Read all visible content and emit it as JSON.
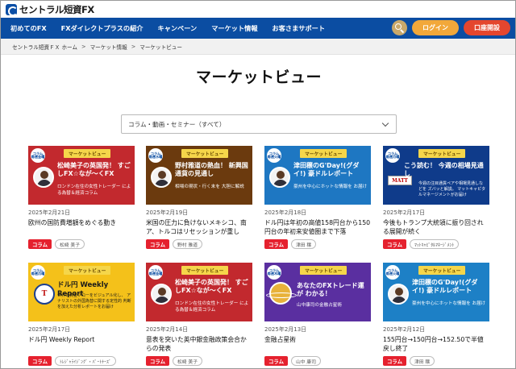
{
  "header": {
    "logo": "セントラル短資FX",
    "nav": [
      "初めてのFX",
      "FXダイレクトプラスの紹介",
      "キャンペーン",
      "マーケット情報",
      "お客さまサポート"
    ],
    "login_label": "ログイン",
    "open_account_label": "口座開設"
  },
  "breadcrumb": [
    "セントラル短資ＦＸ ホーム",
    "マーケット情報",
    "マーケットビュー"
  ],
  "page_title": "マーケットビュー",
  "filter": {
    "selected": "コラム・動画・セミナー（すべて）"
  },
  "cards": [
    {
      "banner_tag": "マーケットビュー",
      "banner_bubble": "コラム 毎週金曜",
      "banner_title": "松崎美子の英国発！ すごしFX☆なが～くFX",
      "banner_sub": "ロンドン在住の女性トレーダー による為替＆経済コラム",
      "date": "2025年2月21日",
      "title": "欧州の国防費増額をめぐる動き",
      "category": "コラム",
      "author": "松崎 美子"
    },
    {
      "banner_tag": "マーケットビュー",
      "banner_bubble": "コラム 毎週水曜",
      "banner_title": "野村雅道の熱血！ 新興国通貨の見通し",
      "banner_sub": "相場の現状・行く末を 大胆に解説",
      "date": "2025年2月19日",
      "title": "米国の圧力に負けないメキシコ、南ア、トルコはリセッションが重し",
      "category": "コラム",
      "author": "野村 雅道"
    },
    {
      "banner_tag": "マーケットビュー",
      "banner_bubble": "コラム 毎週火曜",
      "banner_title": "津田穣のG'Day!(グダイ!) 豪ドルレポート",
      "banner_sub": "豪州を中心にホットな情報を お届け",
      "date": "2025年2月18日",
      "title": "ドル円は年初の高値158円台から150円台の年初来安値圏まで下落",
      "category": "コラム",
      "author": "津田 穣"
    },
    {
      "banner_tag": "マーケットビュー",
      "banner_bubble": "コラム 毎週月曜",
      "banner_title": "こう読む！ 今週の相場見通し",
      "banner_sub": "今週の注目通貨ペアや相場見通しなどを ズバッと解説。 マットキャピタルマネージメントがお届け",
      "banner_logo": "MATT",
      "date": "2025年2月17日",
      "title": "今後もトランプ大統領に振り回される展開が続く",
      "category": "コラム",
      "author": "ﾏｯﾄｷｬﾋﾟﾀﾙﾏﾈｰｼﾞﾒﾝﾄ"
    },
    {
      "banner_tag": "マーケットビュー",
      "banner_bubble": "コラム 毎週月曜",
      "banner_title": "ドル円 Weekly Report",
      "banner_sub": "世界の資金フローをビジュアル化し、 アナリストの外国為替に関する定性的 判断を加えた分析レポートをお届け",
      "banner_logo": "T",
      "date": "2025年2月17日",
      "title": "ドル円 Weekly Report",
      "category": "コラム",
      "author": "ﾄﾚｼﾞｬﾗｲｼﾞﾝｸﾞ・ﾊﾟｰﾄﾅｰｽﾞ"
    },
    {
      "banner_tag": "マーケットビュー",
      "banner_bubble": "コラム 毎週金曜",
      "banner_title": "松崎美子の英国発！ すごしFX☆なが～くFX",
      "banner_sub": "ロンドン在住の女性トレーダー による為替＆経済コラム",
      "date": "2025年2月14日",
      "title": "意表を突いた英中銀金融政策会合からの発表",
      "category": "コラム",
      "author": "松崎 美子"
    },
    {
      "banner_tag": "マーケットビュー",
      "banner_bubble": "コラム 毎週木曜",
      "banner_title": "あなたのFXトレード運が わかる！",
      "banner_sub": "山中康司の金融占星術",
      "date": "2025年2月13日",
      "title": "金融占星術",
      "category": "コラム",
      "author": "山中 康司"
    },
    {
      "banner_tag": "マーケットビュー",
      "banner_bubble": "コラム 毎週火曜",
      "banner_title": "津田穣のG'Day!(グダイ!) 豪ドルレポート",
      "banner_sub": "豪州を中心にホットな情報を お届け",
      "date": "2025年2月12日",
      "title": "155円台→150円台→152.50で半値戻し終了",
      "category": "コラム",
      "author": "津田 穣"
    }
  ]
}
